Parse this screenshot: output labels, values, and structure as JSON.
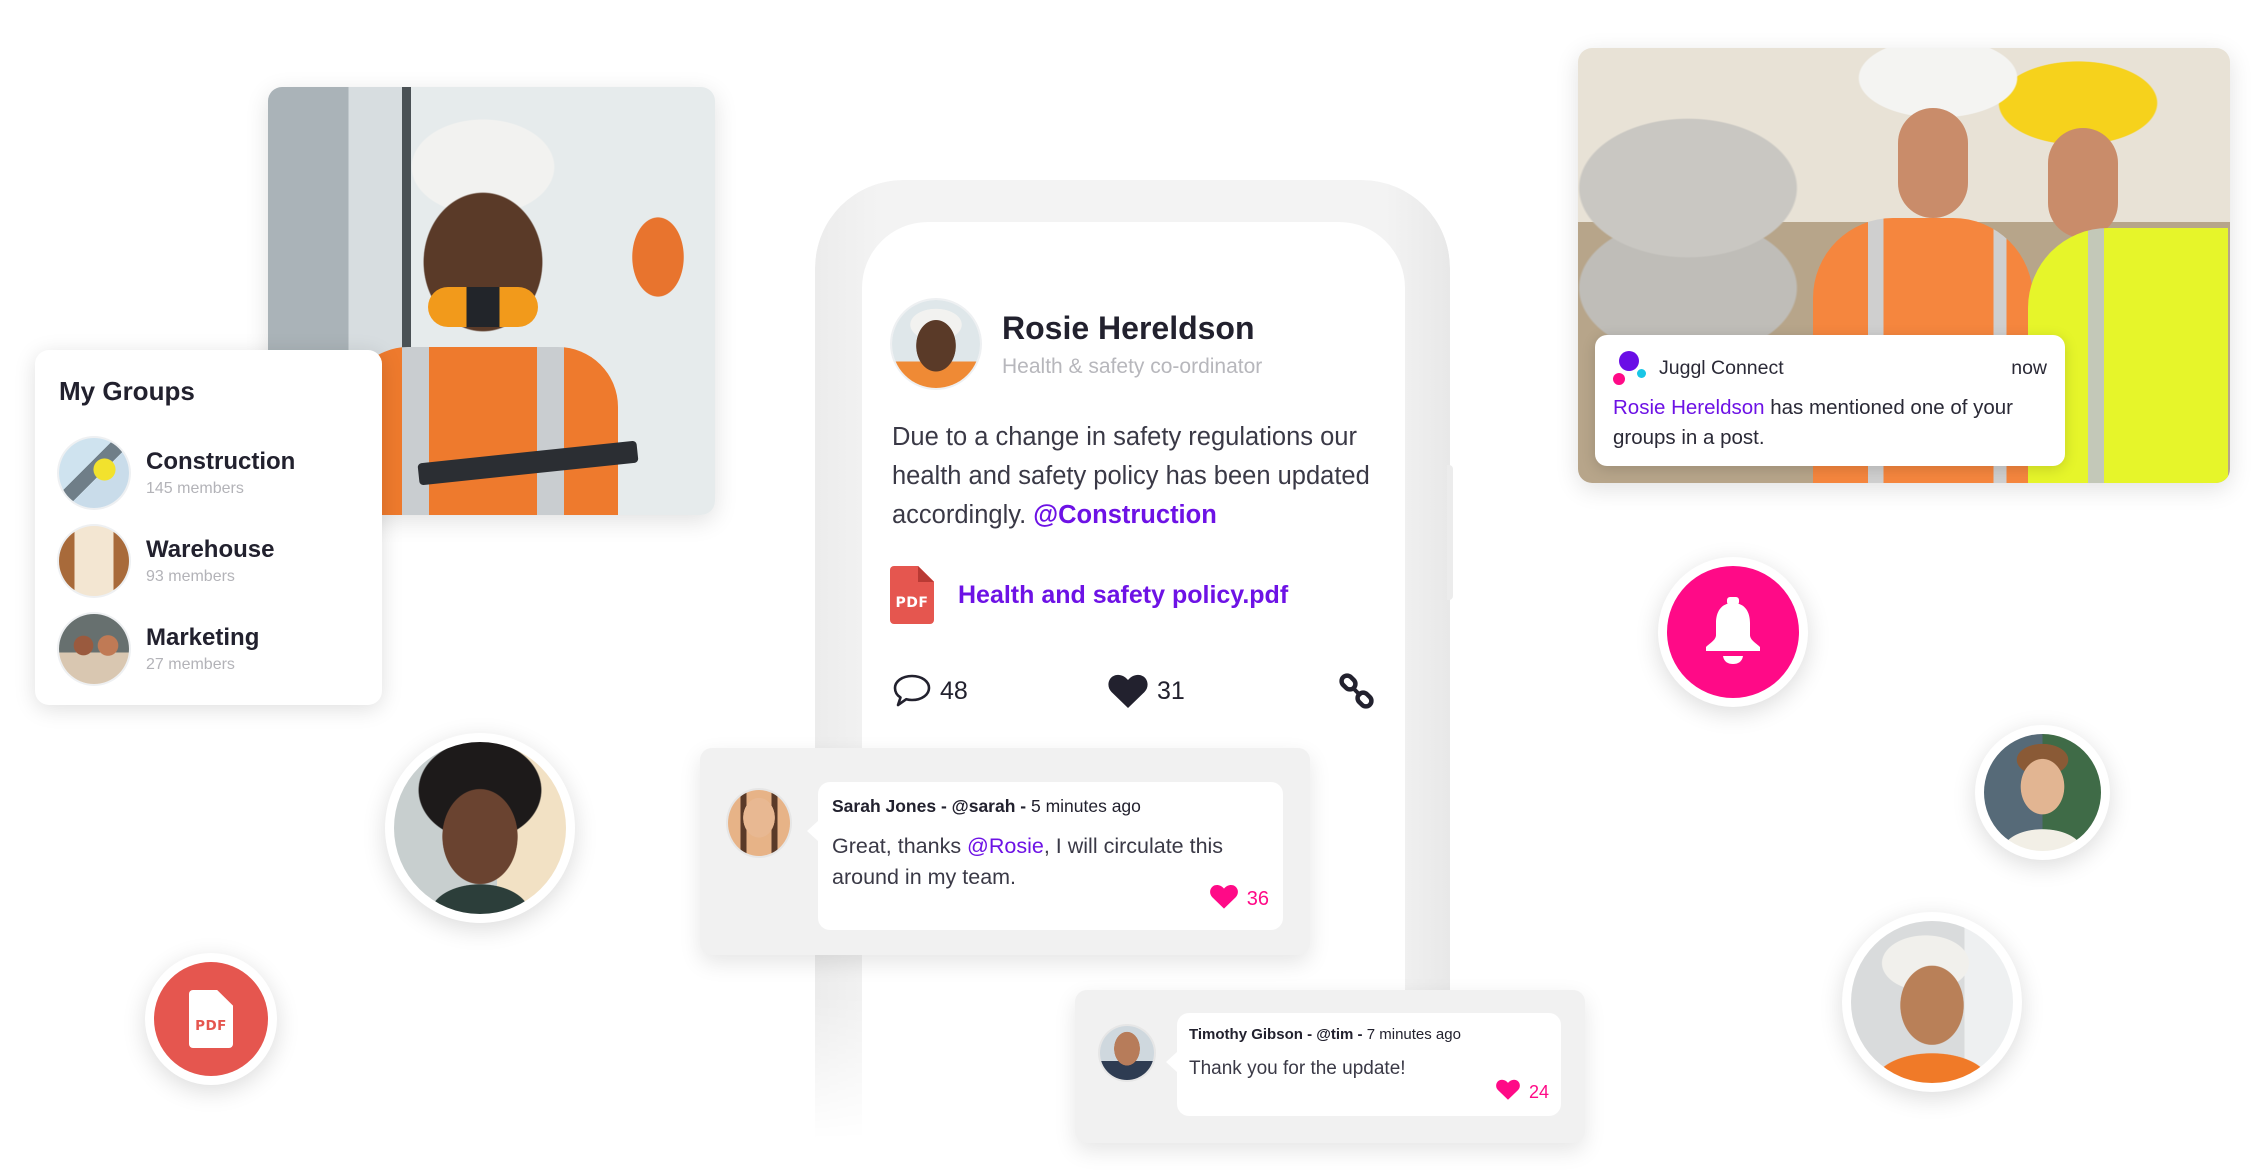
{
  "colors": {
    "accent_purple": "#6d12e5",
    "accent_pink": "#ff0a87",
    "pdf_red": "#e5564f",
    "text_dark": "#22212e",
    "text_muted": "#b3b3b8"
  },
  "photos": [
    {
      "name": "construction-worker-woman-photo",
      "alt": "Smiling construction worker in hard hat and orange vest holding radio and tablet"
    },
    {
      "name": "construction-workers-phone-photo",
      "alt": "Two construction workers looking at a phone"
    }
  ],
  "my_groups": {
    "title": "My Groups",
    "items": [
      {
        "name": "Construction",
        "members": "145 members"
      },
      {
        "name": "Warehouse",
        "members": "93 members"
      },
      {
        "name": "Marketing",
        "members": "27 members"
      }
    ]
  },
  "post": {
    "author": "Rosie Hereldson",
    "role": "Health & safety co-ordinator",
    "body": "Due to a change in safety regulations our health and safety policy has been updated accordingly.",
    "mention": "@Construction",
    "attachment": {
      "icon": "pdf-file-icon",
      "label": "PDF",
      "name": "Health and safety policy.pdf"
    },
    "actions": {
      "comments": "48",
      "likes": "31",
      "comment_icon": "speech-bubble-icon",
      "like_icon": "heart-icon",
      "share_icon": "link-icon"
    }
  },
  "comments": [
    {
      "author": "Sarah Jones",
      "handle": "@sarah",
      "time": "5 minutes ago",
      "text_before": "Great, thanks ",
      "mention": "@Rosie",
      "text_after": ", I will circulate this around in my team.",
      "likes": "36"
    },
    {
      "author": "Timothy Gibson",
      "handle": "@tim",
      "time": "7 minutes ago",
      "text_before": "Thank you for the update!",
      "mention": "",
      "text_after": "",
      "likes": "24"
    }
  ],
  "separator": " - ",
  "notification": {
    "app": "Juggl Connect",
    "time": "now",
    "who": "Rosie Hereldson",
    "message": " has mentioned one of your groups in a post."
  },
  "floating": {
    "bell_icon": "bell-icon",
    "pdf_label": "PDF"
  }
}
